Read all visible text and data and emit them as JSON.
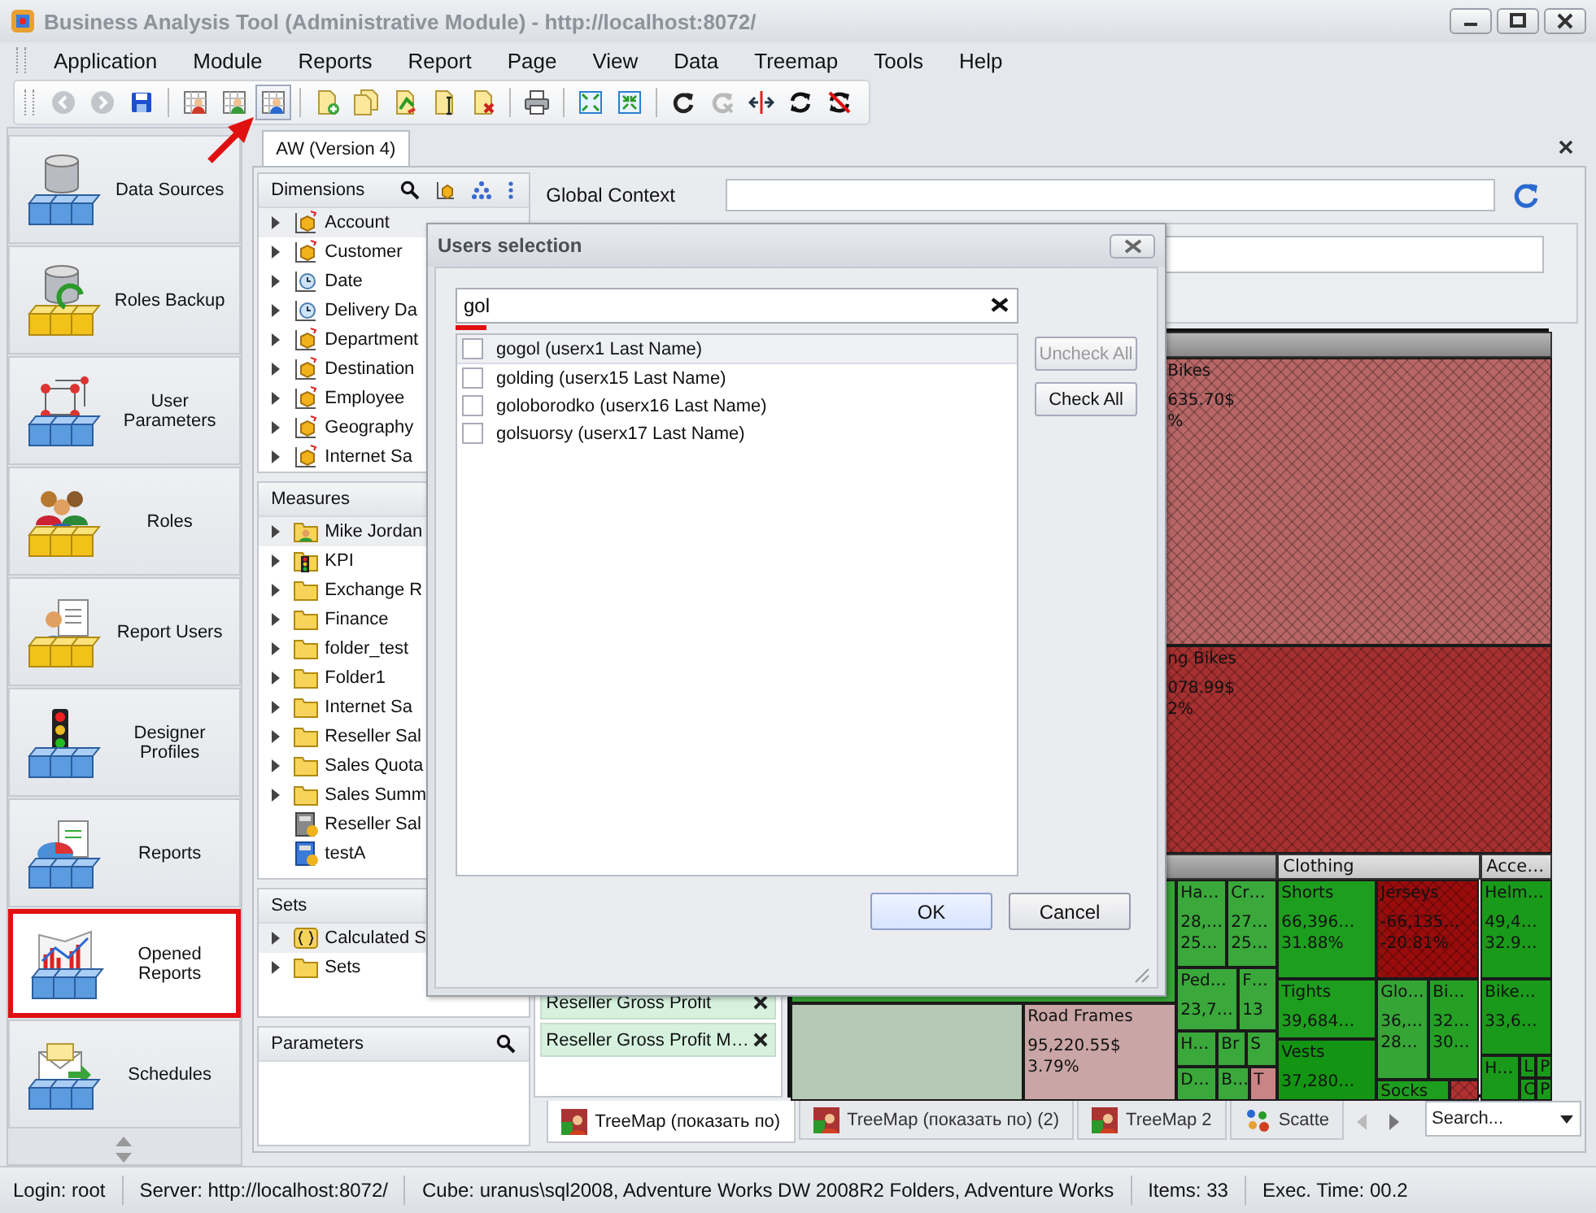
{
  "window": {
    "title": "Business Analysis Tool (Administrative Module) - http://localhost:8072/"
  },
  "menu": [
    "Application",
    "Module",
    "Reports",
    "Report",
    "Page",
    "View",
    "Data",
    "Treemap",
    "Tools",
    "Help"
  ],
  "toolbar": [
    [
      {
        "kind": "back",
        "disabled": true,
        "annotated": false
      },
      {
        "kind": "forward",
        "disabled": true,
        "annotated": false
      },
      {
        "kind": "save",
        "disabled": false,
        "annotated": false
      }
    ],
    [
      {
        "kind": "grid-red",
        "disabled": false,
        "annotated": false
      },
      {
        "kind": "grid-green",
        "disabled": false,
        "annotated": false
      },
      {
        "kind": "grid-blue",
        "disabled": false,
        "annotated": true
      }
    ],
    [
      {
        "kind": "doc-add",
        "disabled": false,
        "annotated": false
      },
      {
        "kind": "docs",
        "disabled": false,
        "annotated": false
      },
      {
        "kind": "doc-refresh",
        "disabled": false,
        "annotated": false
      },
      {
        "kind": "doc-edit",
        "disabled": false,
        "annotated": false
      },
      {
        "kind": "doc-delete",
        "disabled": false,
        "annotated": false
      }
    ],
    [
      {
        "kind": "print",
        "disabled": false,
        "annotated": false
      }
    ],
    [
      {
        "kind": "expand",
        "disabled": false,
        "annotated": false
      },
      {
        "kind": "collapse",
        "disabled": false,
        "annotated": false
      }
    ],
    [
      {
        "kind": "refresh",
        "disabled": false,
        "annotated": false
      },
      {
        "kind": "refresh-off",
        "disabled": true,
        "annotated": false
      },
      {
        "kind": "split",
        "disabled": false,
        "annotated": false
      },
      {
        "kind": "sync",
        "disabled": false,
        "annotated": false
      },
      {
        "kind": "sync-off",
        "disabled": false,
        "annotated": false
      }
    ]
  ],
  "sidebar": {
    "items": [
      {
        "label": "Data Sources",
        "kind": "database",
        "selected": false,
        "annotated": false
      },
      {
        "label": "Roles Backup",
        "kind": "database-sync",
        "selected": false,
        "annotated": false
      },
      {
        "label": "User Parameters",
        "kind": "molecule",
        "selected": false,
        "annotated": false
      },
      {
        "label": "Roles",
        "kind": "people",
        "selected": false,
        "annotated": false
      },
      {
        "label": "Report Users",
        "kind": "user-doc",
        "selected": false,
        "annotated": false
      },
      {
        "label": "Designer Profiles",
        "kind": "traffic-light",
        "selected": false,
        "annotated": false
      },
      {
        "label": "Reports",
        "kind": "pie",
        "selected": false,
        "annotated": false
      },
      {
        "label": "Opened Reports",
        "kind": "line-chart",
        "selected": true,
        "annotated": true
      },
      {
        "label": "Schedules",
        "kind": "envelope",
        "selected": false,
        "annotated": false
      }
    ]
  },
  "document_tab": {
    "label": "AW (Version 4)"
  },
  "dimensions": {
    "title": "Dimensions",
    "items": [
      {
        "label": "Account",
        "kind": "cube",
        "expandable": true,
        "selected": true
      },
      {
        "label": "Customer",
        "kind": "cube",
        "expandable": true,
        "selected": false
      },
      {
        "label": "Date",
        "kind": "time",
        "expandable": true,
        "selected": false
      },
      {
        "label": "Delivery Da",
        "kind": "time",
        "expandable": true,
        "selected": false
      },
      {
        "label": "Department",
        "kind": "cube",
        "expandable": true,
        "selected": false
      },
      {
        "label": "Destination",
        "kind": "cube",
        "expandable": true,
        "selected": false
      },
      {
        "label": "Employee",
        "kind": "cube",
        "expandable": true,
        "selected": false
      },
      {
        "label": "Geography",
        "kind": "cube",
        "expandable": true,
        "selected": false
      },
      {
        "label": "Internet Sa",
        "kind": "cube",
        "expandable": true,
        "selected": false
      }
    ]
  },
  "measures": {
    "title": "Measures",
    "items": [
      {
        "label": "Mike Jordan",
        "kind": "user-folder",
        "expandable": true,
        "selected": true
      },
      {
        "label": "KPI",
        "kind": "kpi",
        "expandable": true,
        "selected": false
      },
      {
        "label": "Exchange R",
        "kind": "folder",
        "expandable": true,
        "selected": false
      },
      {
        "label": "Finance",
        "kind": "folder",
        "expandable": true,
        "selected": false
      },
      {
        "label": "folder_test",
        "kind": "folder",
        "expandable": true,
        "selected": false
      },
      {
        "label": "Folder1",
        "kind": "folder",
        "expandable": true,
        "selected": false
      },
      {
        "label": "Internet Sa",
        "kind": "folder",
        "expandable": true,
        "selected": false
      },
      {
        "label": "Reseller Sal",
        "kind": "folder",
        "expandable": true,
        "selected": false
      },
      {
        "label": "Sales Quota",
        "kind": "folder",
        "expandable": true,
        "selected": false
      },
      {
        "label": "Sales Summ",
        "kind": "folder",
        "expandable": true,
        "selected": false
      },
      {
        "label": "Reseller Sal",
        "kind": "calc",
        "expandable": false,
        "selected": false
      },
      {
        "label": "testA",
        "kind": "calc-blue",
        "expandable": false,
        "selected": false
      }
    ]
  },
  "sets": {
    "title": "Sets",
    "items": [
      {
        "label": "Calculated S",
        "kind": "set",
        "expandable": true,
        "selected": true
      },
      {
        "label": "Sets",
        "kind": "folder",
        "expandable": true,
        "selected": false
      }
    ]
  },
  "parameters": {
    "title": "Parameters"
  },
  "global_context": {
    "label": "Global Context"
  },
  "selected_measures": [
    "Reseller Gross Profit",
    "Reseller Gross Profit M…"
  ],
  "treemap": {
    "groups": [
      "Clothing",
      "Acce…"
    ],
    "cells": [
      {
        "lines": [
          "Bikes",
          "635.70$",
          "%"
        ],
        "color": "#b86666",
        "hatched": true
      },
      {
        "lines": [
          "ng Bikes",
          "078.99$",
          "2%"
        ],
        "color": "#a63030",
        "hatched": true
      },
      {
        "color": "#35a535",
        "hatched": false
      },
      {
        "color": "#b6c9b5",
        "hatched": false
      },
      {
        "lines": [
          "Road Frames",
          "95,220.55$",
          "3.79%"
        ],
        "color": "#c9a5a5",
        "hatched": false
      },
      {
        "lines": [
          "Ha…",
          "28,…",
          "25…"
        ],
        "color": "#3aa83a",
        "hatched": false
      },
      {
        "lines": [
          "Cr…",
          "27…",
          "25…"
        ],
        "color": "#3aa83a",
        "hatched": false
      },
      {
        "lines": [
          "Ped…",
          "23,7…"
        ],
        "color": "#3aa83a",
        "hatched": false
      },
      {
        "lines": [
          "F…",
          "13"
        ],
        "color": "#3aa83a",
        "hatched": false
      },
      {
        "lines": [
          "H…"
        ],
        "color": "#3aa83a",
        "hatched": false
      },
      {
        "lines": [
          "Br"
        ],
        "color": "#3aa83a",
        "hatched": false
      },
      {
        "lines": [
          "S"
        ],
        "color": "#3aa83a",
        "hatched": false
      },
      {
        "lines": [
          "D…"
        ],
        "color": "#3aa83a",
        "hatched": false
      },
      {
        "lines": [
          "B…"
        ],
        "color": "#3aa83a",
        "hatched": false
      },
      {
        "lines": [
          "T"
        ],
        "color": "#c98585",
        "hatched": false
      },
      {
        "lines": [
          "Shorts",
          "66,396…",
          "31.88%"
        ],
        "color": "#1e9e1e",
        "hatched": false
      },
      {
        "lines": [
          "Jerseys",
          "-66,135…",
          "-20.81%"
        ],
        "color": "#9a0c0c",
        "hatched": true
      },
      {
        "lines": [
          "Tights",
          "39,684…"
        ],
        "color": "#1e9e1e",
        "hatched": false
      },
      {
        "lines": [
          "Vests",
          "37,280…"
        ],
        "color": "#139513",
        "hatched": false
      },
      {
        "lines": [
          "Glo…",
          "36,…",
          "28…"
        ],
        "color": "#35a535",
        "hatched": false
      },
      {
        "lines": [
          "Bi…",
          "32…",
          "30…"
        ],
        "color": "#25a025",
        "hatched": false
      },
      {
        "lines": [
          "Socks"
        ],
        "color": "#1e9e1e",
        "hatched": false
      },
      {
        "color": "#b03030",
        "hatched": true
      },
      {
        "lines": [
          "Helm…",
          "49,4…",
          "32.9…"
        ],
        "color": "#1a9a1a",
        "hatched": false
      },
      {
        "lines": [
          "Bike…",
          "33,6…"
        ],
        "color": "#1a9a1a",
        "hatched": false
      },
      {
        "lines": [
          "H…"
        ],
        "color": "#1a9a1a",
        "hatched": false
      },
      {
        "lines": [
          "L"
        ],
        "color": "#1a9a1a",
        "hatched": false
      },
      {
        "lines": [
          "P"
        ],
        "color": "#1a9a1a",
        "hatched": false
      },
      {
        "lines": [
          "C"
        ],
        "color": "#1a9a1a",
        "hatched": false
      },
      {
        "lines": [
          "P"
        ],
        "color": "#1a9a1a",
        "hatched": false
      }
    ]
  },
  "report_tabs": [
    {
      "label": "TreeMap (показать по)",
      "kind": "treemap",
      "selected": true
    },
    {
      "label": "TreeMap (показать по) (2)",
      "kind": "treemap",
      "selected": false
    },
    {
      "label": "TreeMap 2",
      "kind": "treemap",
      "selected": false
    },
    {
      "label": "Scatte",
      "kind": "scatter",
      "selected": false
    }
  ],
  "tab_search": {
    "placeholder": "Search..."
  },
  "dialog": {
    "title": "Users selection",
    "search": {
      "value": "gol",
      "annotated": true
    },
    "users": [
      {
        "label": "gogol (userx1 Last Name)",
        "checked": false,
        "selected": true
      },
      {
        "label": "golding (userx15 Last Name)",
        "checked": false,
        "selected": false
      },
      {
        "label": "goloborodko (userx16 Last Name)",
        "checked": false,
        "selected": false
      },
      {
        "label": "golsuorsy (userx17 Last Name)",
        "checked": false,
        "selected": false
      }
    ],
    "side_buttons": [
      {
        "label": "Uncheck All",
        "disabled": true
      },
      {
        "label": "Check All",
        "disabled": false
      }
    ],
    "actions": [
      {
        "label": "OK",
        "default": true
      },
      {
        "label": "Cancel",
        "default": false
      }
    ]
  },
  "status_bar": [
    "Login: root",
    "Server: http://localhost:8072/",
    "Cube: uranus\\sql2008, Adventure Works DW 2008R2 Folders, Adventure Works",
    "Items: 33",
    "Exec. Time: 00.2"
  ]
}
